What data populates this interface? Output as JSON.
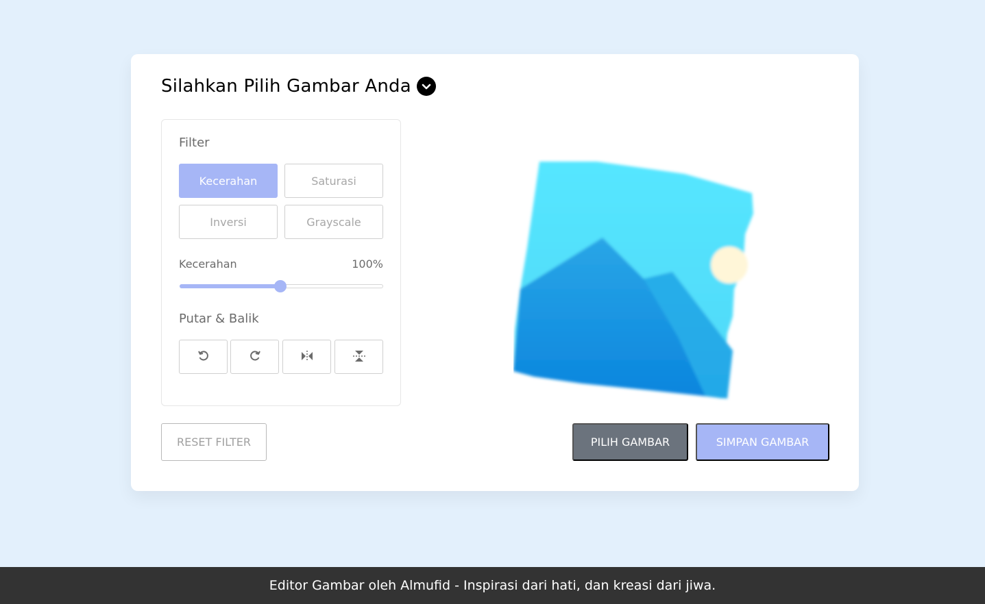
{
  "header": {
    "title": "Silahkan Pilih Gambar Anda",
    "title_icon": "chevron-down-circle-icon"
  },
  "filter": {
    "heading": "Filter",
    "options": [
      {
        "label": "Kecerahan",
        "active": true
      },
      {
        "label": "Saturasi",
        "active": false
      },
      {
        "label": "Inversi",
        "active": false
      },
      {
        "label": "Grayscale",
        "active": false
      }
    ],
    "slider": {
      "name": "Kecerahan",
      "value": "100%",
      "level": 0.5
    }
  },
  "rotate": {
    "heading": "Putar & Balik",
    "buttons": [
      "rotate-left-icon",
      "rotate-right-icon",
      "flip-horizontal-icon",
      "flip-vertical-icon"
    ]
  },
  "actions": {
    "reset": "RESET FILTER",
    "choose": "PILIH GAMBAR",
    "save": "SIMPAN GAMBAR"
  },
  "preview": {
    "icon": "image-placeholder-icon"
  },
  "footer": {
    "text": "Editor Gambar oleh Almufid - Inspirasi dari hati, dan kreasi dari jiwa."
  },
  "colors": {
    "accent": "#a6b6f6",
    "dark_button": "#6b737d",
    "background": "#e3f0fc",
    "footer": "#333333"
  }
}
